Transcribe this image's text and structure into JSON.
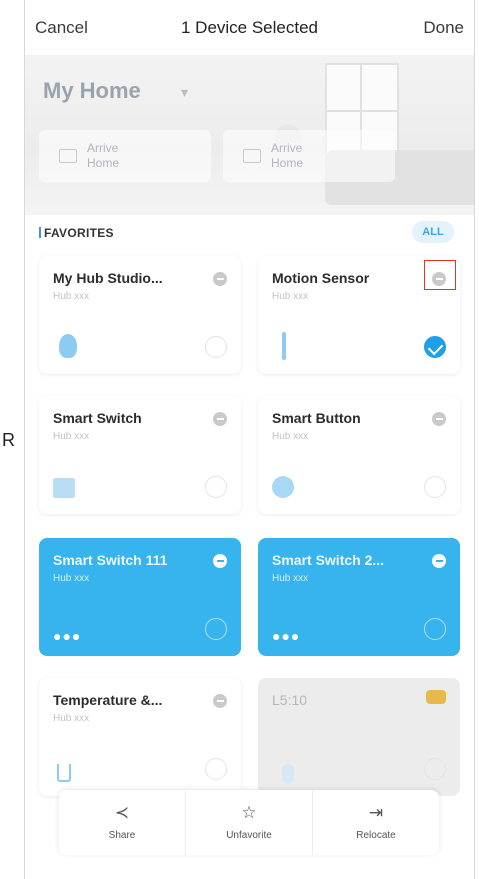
{
  "stray_text": "R",
  "nav": {
    "cancel": "Cancel",
    "title": "1 Device Selected",
    "done": "Done"
  },
  "home": {
    "title": "My Home",
    "modes": [
      {
        "label": "Arrive Home",
        "icon": "home-mode-icon"
      },
      {
        "label": "Arrive Home",
        "icon": "home-mode-icon"
      }
    ]
  },
  "favorites": {
    "label": "FAVORITES",
    "all_label": "ALL",
    "devices": [
      {
        "name": "My Hub Studio...",
        "sub": "Hub xxx",
        "icon": "hub-icon",
        "state": "default",
        "selected": false
      },
      {
        "name": "Motion Sensor",
        "sub": "Hub xxx",
        "icon": "motion-sensor-icon",
        "state": "default",
        "selected": true
      },
      {
        "name": "Smart Switch",
        "sub": "Hub xxx",
        "icon": "switch-icon",
        "state": "default",
        "selected": false
      },
      {
        "name": "Smart Button",
        "sub": "Hub xxx",
        "icon": "button-icon",
        "state": "default",
        "selected": false
      },
      {
        "name": "Smart Switch 111",
        "sub": "Hub xxx",
        "icon": "dots-icon",
        "state": "on",
        "selected": false
      },
      {
        "name": "Smart Switch 2...",
        "sub": "Hub xxx",
        "icon": "dots-icon",
        "state": "on",
        "selected": false
      },
      {
        "name": "Temperature &...",
        "sub": "Hub xxx",
        "icon": "thermometer-icon",
        "state": "default",
        "selected": false
      },
      {
        "name": "L5:10",
        "sub": "",
        "icon": "bulb-icon",
        "state": "disabled",
        "selected": false
      }
    ]
  },
  "actions": [
    {
      "label": "Share",
      "icon": "share-icon"
    },
    {
      "label": "Unfavorite",
      "icon": "unfavorite-icon"
    },
    {
      "label": "Relocate",
      "icon": "relocate-icon"
    }
  ],
  "colors": {
    "accent": "#37b4ee",
    "check": "#1f9fe8",
    "highlight": "#e0352b"
  }
}
